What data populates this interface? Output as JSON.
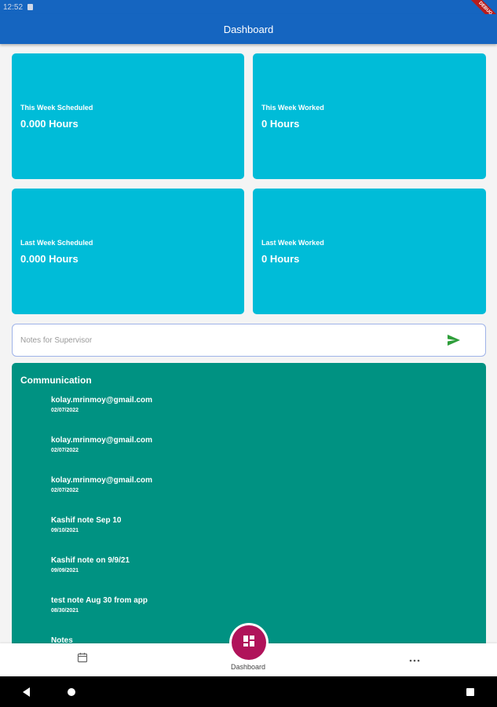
{
  "status_bar": {
    "time": "12:52"
  },
  "debug_banner": "DEBUG",
  "app_bar": {
    "title": "Dashboard"
  },
  "cards": [
    {
      "title": "This Week Scheduled",
      "value": "0.000 Hours"
    },
    {
      "title": "This Week Worked",
      "value": "0 Hours"
    },
    {
      "title": "Last Week Scheduled",
      "value": "0.000 Hours"
    },
    {
      "title": "Last Week Worked",
      "value": "0 Hours"
    }
  ],
  "notes": {
    "placeholder": "Notes for Supervisor",
    "value": ""
  },
  "communication": {
    "title": "Communication",
    "items": [
      {
        "title": "kolay.mrinmoy@gmail.com",
        "date": "02/07/2022"
      },
      {
        "title": "kolay.mrinmoy@gmail.com",
        "date": "02/07/2022"
      },
      {
        "title": "kolay.mrinmoy@gmail.com",
        "date": "02/07/2022"
      },
      {
        "title": "Kashif note Sep 10",
        "date": "09/10/2021"
      },
      {
        "title": "Kashif note on 9/9/21",
        "date": "09/09/2021"
      },
      {
        "title": "test note Aug 30 from app",
        "date": "08/30/2021"
      },
      {
        "title": "Notes",
        "date": ""
      }
    ]
  },
  "bottom_nav": {
    "center_label": "Dashboard"
  },
  "colors": {
    "app_bar": "#1565c0",
    "card": "#00bcd8",
    "communication": "#009282",
    "fab": "#b0135a",
    "send": "#2e9e3a"
  }
}
